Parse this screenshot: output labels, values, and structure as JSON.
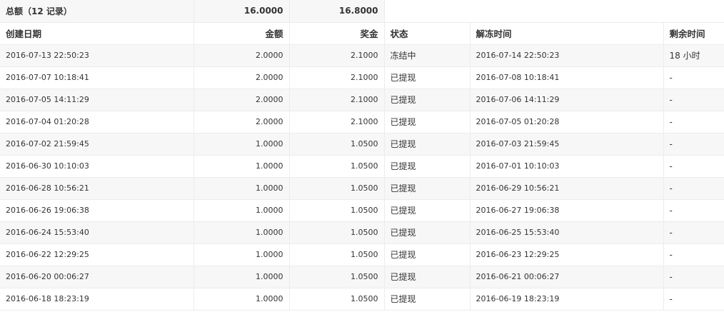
{
  "summary": {
    "label": "总额（12 记录）",
    "amount_total": "16.0000",
    "bonus_total": "16.8000"
  },
  "columns": {
    "created": "创建日期",
    "amount": "金额",
    "bonus": "奖金",
    "status": "状态",
    "unfreeze": "解冻时间",
    "remaining": "剩余时间"
  },
  "rows": [
    {
      "created": "2016-07-13 22:50:23",
      "amount": "2.0000",
      "bonus": "2.1000",
      "status": "冻结中",
      "unfreeze": "2016-07-14 22:50:23",
      "remaining": "18 小时"
    },
    {
      "created": "2016-07-07 10:18:41",
      "amount": "2.0000",
      "bonus": "2.1000",
      "status": "已提现",
      "unfreeze": "2016-07-08 10:18:41",
      "remaining": "-"
    },
    {
      "created": "2016-07-05 14:11:29",
      "amount": "2.0000",
      "bonus": "2.1000",
      "status": "已提现",
      "unfreeze": "2016-07-06 14:11:29",
      "remaining": "-"
    },
    {
      "created": "2016-07-04 01:20:28",
      "amount": "2.0000",
      "bonus": "2.1000",
      "status": "已提现",
      "unfreeze": "2016-07-05 01:20:28",
      "remaining": "-"
    },
    {
      "created": "2016-07-02 21:59:45",
      "amount": "1.0000",
      "bonus": "1.0500",
      "status": "已提现",
      "unfreeze": "2016-07-03 21:59:45",
      "remaining": "-"
    },
    {
      "created": "2016-06-30 10:10:03",
      "amount": "1.0000",
      "bonus": "1.0500",
      "status": "已提现",
      "unfreeze": "2016-07-01 10:10:03",
      "remaining": "-"
    },
    {
      "created": "2016-06-28 10:56:21",
      "amount": "1.0000",
      "bonus": "1.0500",
      "status": "已提现",
      "unfreeze": "2016-06-29 10:56:21",
      "remaining": "-"
    },
    {
      "created": "2016-06-26 19:06:38",
      "amount": "1.0000",
      "bonus": "1.0500",
      "status": "已提现",
      "unfreeze": "2016-06-27 19:06:38",
      "remaining": "-"
    },
    {
      "created": "2016-06-24 15:53:40",
      "amount": "1.0000",
      "bonus": "1.0500",
      "status": "已提现",
      "unfreeze": "2016-06-25 15:53:40",
      "remaining": "-"
    },
    {
      "created": "2016-06-22 12:29:25",
      "amount": "1.0000",
      "bonus": "1.0500",
      "status": "已提现",
      "unfreeze": "2016-06-23 12:29:25",
      "remaining": "-"
    },
    {
      "created": "2016-06-20 00:06:27",
      "amount": "1.0000",
      "bonus": "1.0500",
      "status": "已提现",
      "unfreeze": "2016-06-21 00:06:27",
      "remaining": "-"
    },
    {
      "created": "2016-06-18 18:23:19",
      "amount": "1.0000",
      "bonus": "1.0500",
      "status": "已提现",
      "unfreeze": "2016-06-19 18:23:19",
      "remaining": "-"
    }
  ],
  "colors": {
    "row_alt": "#f7f7f7",
    "border": "#ececec",
    "text": "#333333"
  }
}
